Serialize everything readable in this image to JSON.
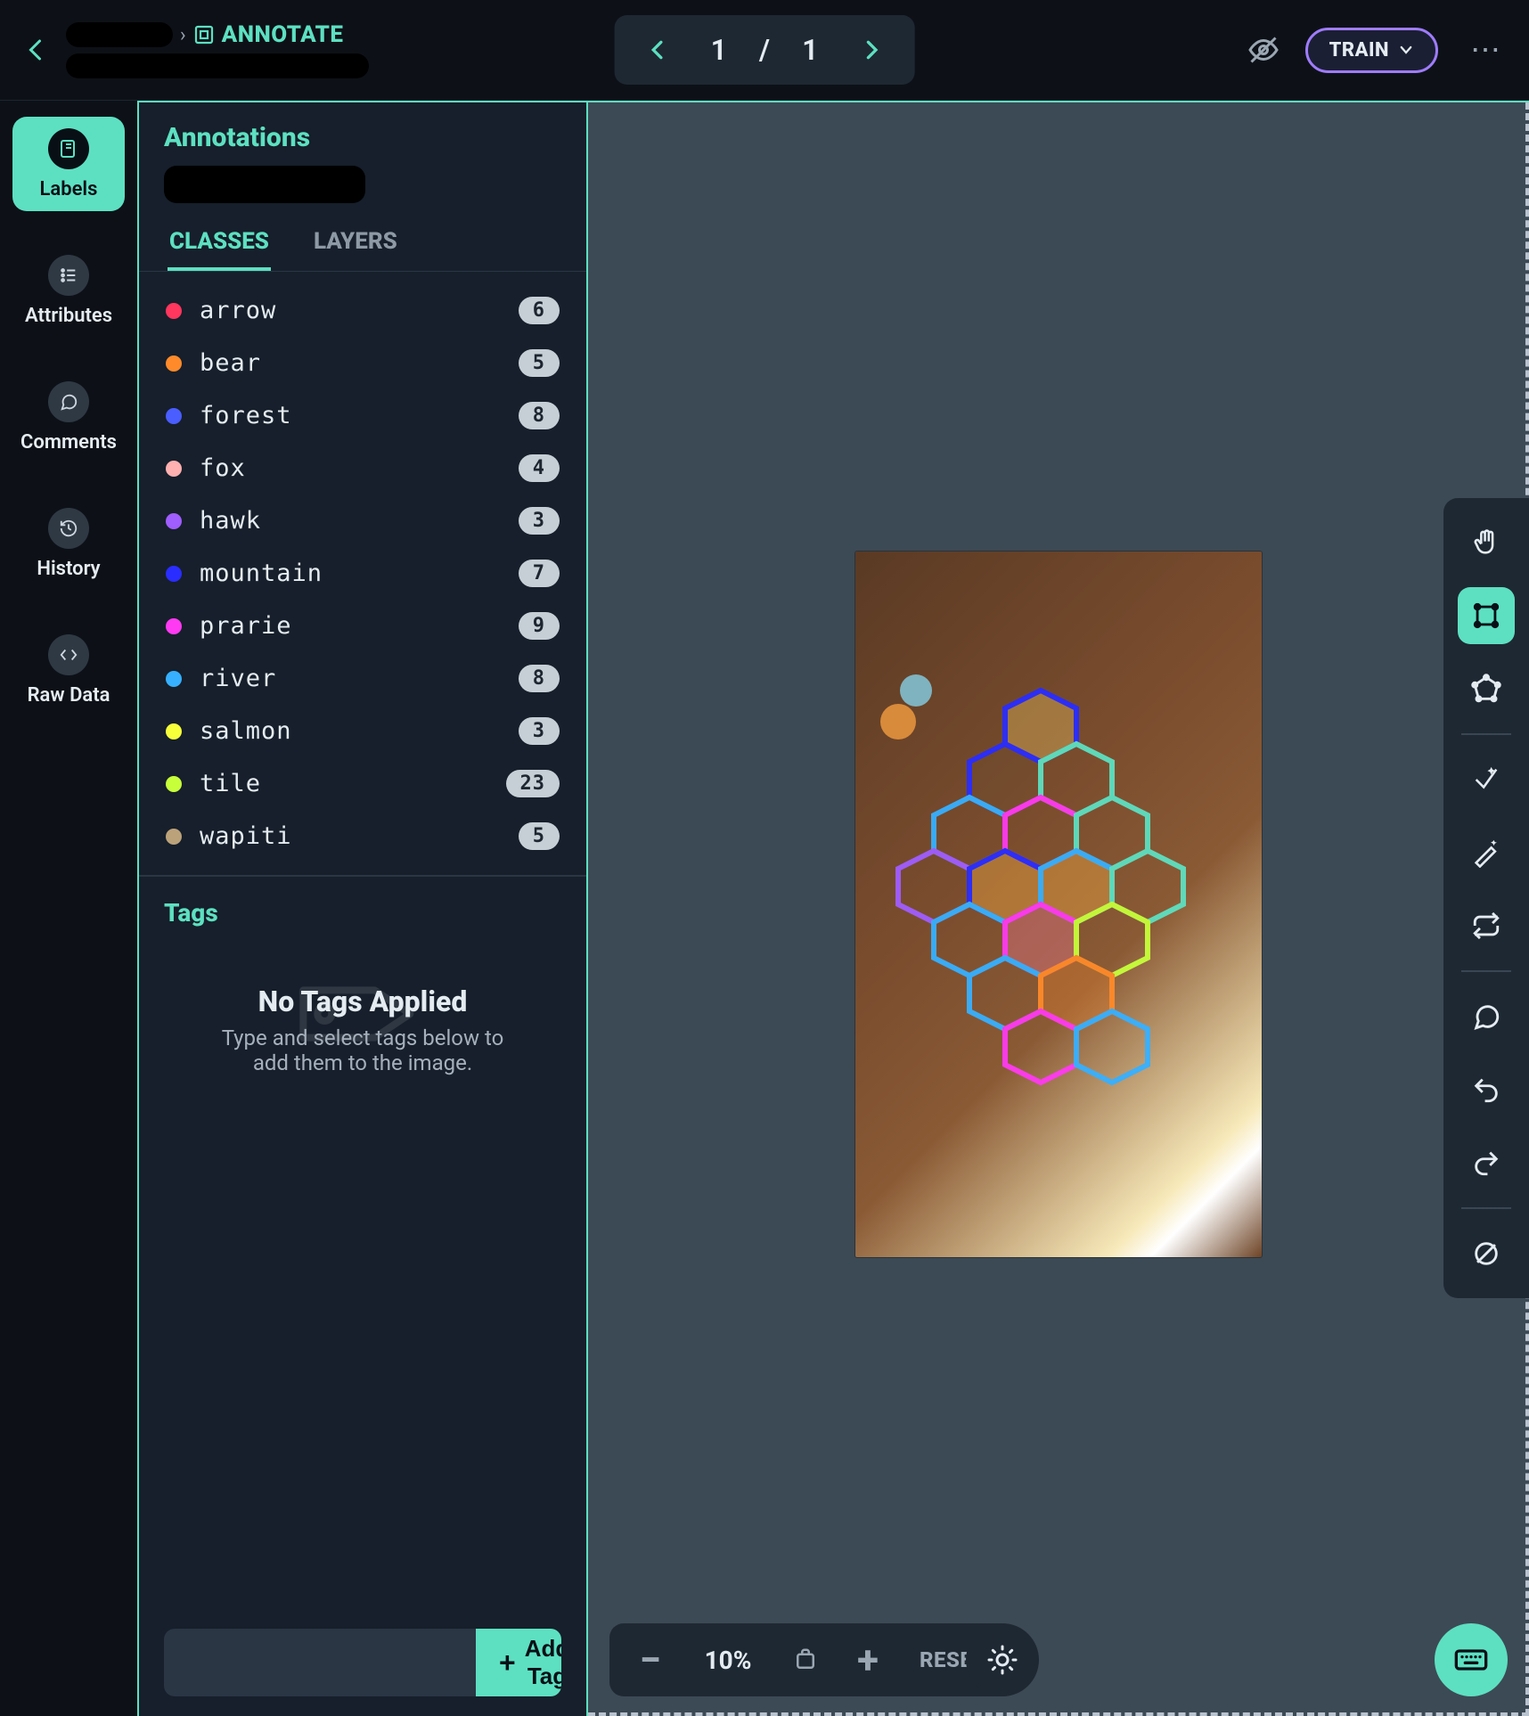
{
  "header": {
    "annotate_label": "ANNOTATE",
    "page_current": "1",
    "page_sep": "/",
    "page_total": "1",
    "train_label": "TRAIN"
  },
  "rail": {
    "labels": "Labels",
    "attributes": "Attributes",
    "comments": "Comments",
    "history": "History",
    "rawdata": "Raw Data"
  },
  "panel": {
    "title": "Annotations",
    "tab_classes": "CLASSES",
    "tab_layers": "LAYERS",
    "classes": [
      {
        "name": "arrow",
        "count": "6",
        "color": "#ff365e"
      },
      {
        "name": "bear",
        "count": "5",
        "color": "#ff8a2a"
      },
      {
        "name": "forest",
        "count": "8",
        "color": "#4a5dff"
      },
      {
        "name": "fox",
        "count": "4",
        "color": "#ffb0b0"
      },
      {
        "name": "hawk",
        "count": "3",
        "color": "#a05dff"
      },
      {
        "name": "mountain",
        "count": "7",
        "color": "#2a2dff"
      },
      {
        "name": "prarie",
        "count": "9",
        "color": "#ff3af2"
      },
      {
        "name": "river",
        "count": "8",
        "color": "#37b0ff"
      },
      {
        "name": "salmon",
        "count": "3",
        "color": "#f7ff3a"
      },
      {
        "name": "tile",
        "count": "23",
        "color": "#c7ff3a"
      },
      {
        "name": "wapiti",
        "count": "5",
        "color": "#bca27a"
      }
    ]
  },
  "tags": {
    "title": "Tags",
    "empty_title": "No Tags Applied",
    "empty_body": "Type and select tags below to add them to the image.",
    "add_label": "Add Tag",
    "input_placeholder": ""
  },
  "zoom": {
    "value": "10%",
    "reset": "RESET"
  }
}
